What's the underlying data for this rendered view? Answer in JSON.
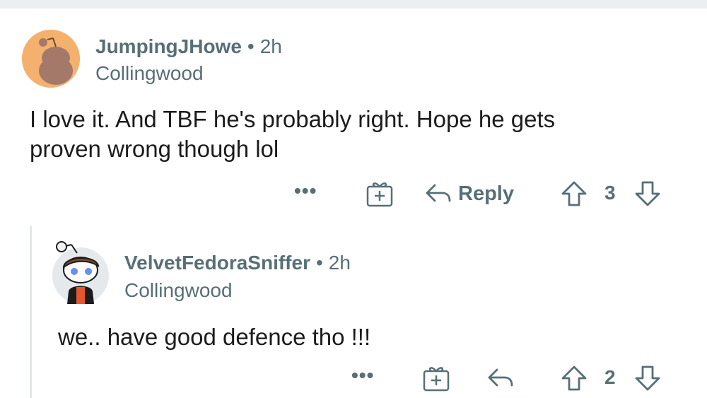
{
  "comments": [
    {
      "author": "JumpingJHowe",
      "separator": "•",
      "time": "2h",
      "flair": "Collingwood",
      "body_lines": [
        "I love it. And TBF he's probably right. Hope he gets",
        "proven wrong though lol"
      ],
      "more": "•••",
      "reply_label": "Reply",
      "score": "3"
    },
    {
      "author": "VelvetFedoraSniffer",
      "separator": "•",
      "time": "2h",
      "flair": "Collingwood",
      "body_lines": [
        "we.. have good defence tho !!!"
      ],
      "more": "•••",
      "score": "2"
    }
  ],
  "colors": {
    "meta_gray": "#576f76",
    "text": "#1c1c1c",
    "avatar1_bg": "#f4b16e",
    "thread_line": "#e3e6e8"
  },
  "icons": [
    "award-icon",
    "reply-arrow-icon",
    "upvote-icon",
    "downvote-icon",
    "more-icon"
  ]
}
